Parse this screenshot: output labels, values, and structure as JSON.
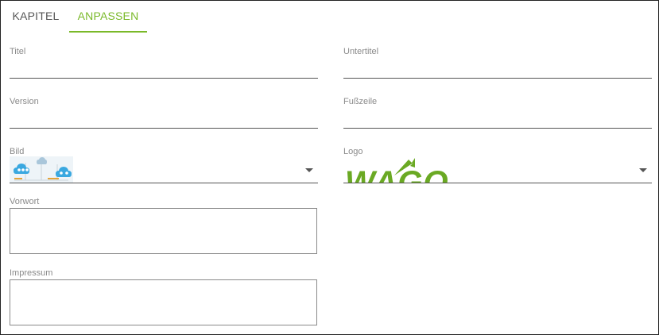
{
  "tabs": [
    {
      "label": "KAPITEL",
      "active": false
    },
    {
      "label": "ANPASSEN",
      "active": true
    }
  ],
  "accent_color": "#7ab929",
  "form": {
    "titel": {
      "label": "Titel",
      "value": ""
    },
    "untertitel": {
      "label": "Untertitel",
      "value": ""
    },
    "version": {
      "label": "Version",
      "value": ""
    },
    "fusszeile": {
      "label": "Fußzeile",
      "value": ""
    },
    "bild": {
      "label": "Bild",
      "selected_icon": "cloud-network-thumbnail-icon"
    },
    "logo": {
      "label": "Logo",
      "selected_logo_text": "WAGO"
    },
    "vorwort": {
      "label": "Vorwort",
      "value": ""
    },
    "impressum": {
      "label": "Impressum",
      "value": ""
    }
  }
}
